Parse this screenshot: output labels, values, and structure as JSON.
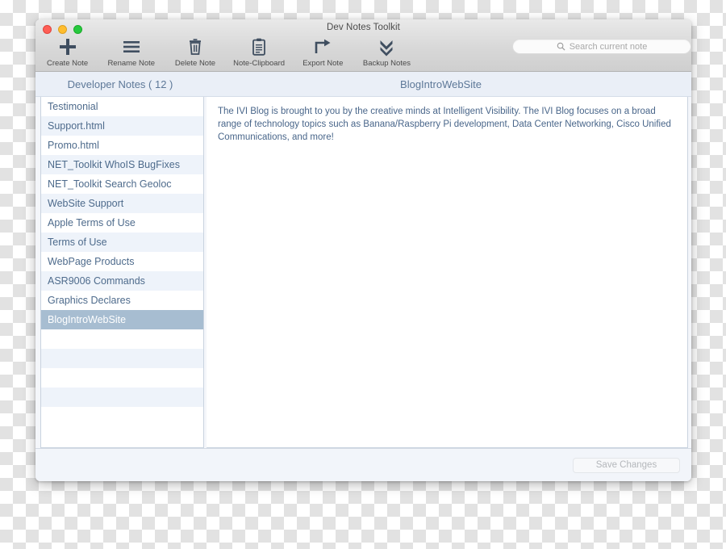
{
  "window": {
    "title": "Dev Notes Toolkit",
    "traffic_lights": [
      "close",
      "minimize",
      "maximize"
    ]
  },
  "toolbar": {
    "buttons": [
      {
        "label": "Create Note",
        "icon": "plus-icon"
      },
      {
        "label": "Rename Note",
        "icon": "hamburger-lines-icon"
      },
      {
        "label": "Delete Note",
        "icon": "trash-icon"
      },
      {
        "label": "Note-Clipboard",
        "icon": "clipboard-icon"
      },
      {
        "label": "Export Note",
        "icon": "export-arrow-icon"
      },
      {
        "label": "Backup Notes",
        "icon": "double-chevron-down-icon"
      }
    ],
    "search": {
      "placeholder": "Search current note",
      "value": "",
      "icon": "search-icon"
    }
  },
  "header": {
    "sidebar_title": "Developer Notes ( 12 )",
    "note_title": "BlogIntroWebSite"
  },
  "sidebar": {
    "items": [
      {
        "label": "Testimonial",
        "selected": false
      },
      {
        "label": "Support.html",
        "selected": false
      },
      {
        "label": "Promo.html",
        "selected": false
      },
      {
        "label": "NET_Toolkit WhoIS BugFixes",
        "selected": false
      },
      {
        "label": "NET_Toolkit Search Geoloc",
        "selected": false
      },
      {
        "label": "WebSite Support",
        "selected": false
      },
      {
        "label": "Apple Terms of Use",
        "selected": false
      },
      {
        "label": "Terms of Use",
        "selected": false
      },
      {
        "label": "WebPage Products",
        "selected": false
      },
      {
        "label": "ASR9006 Commands",
        "selected": false
      },
      {
        "label": "Graphics Declares",
        "selected": false
      },
      {
        "label": "BlogIntroWebSite",
        "selected": true
      }
    ],
    "empty_rows": 5
  },
  "editor": {
    "body": "The IVI Blog is brought to you by the creative minds at Intelligent Visibility. The IVI Blog focuses on a broad range of technology topics such as Banana/Raspberry Pi development, Data Center Networking, Cisco Unified Communications, and more!"
  },
  "footer": {
    "save_label": "Save Changes",
    "save_enabled": false
  },
  "colors": {
    "selected_row": "#a7bdd1",
    "stripe_row": "#eef3fa",
    "header_band": "#eaeff7",
    "text_blue": "#4e6b8c",
    "icon_dark": "#3f4e60"
  }
}
